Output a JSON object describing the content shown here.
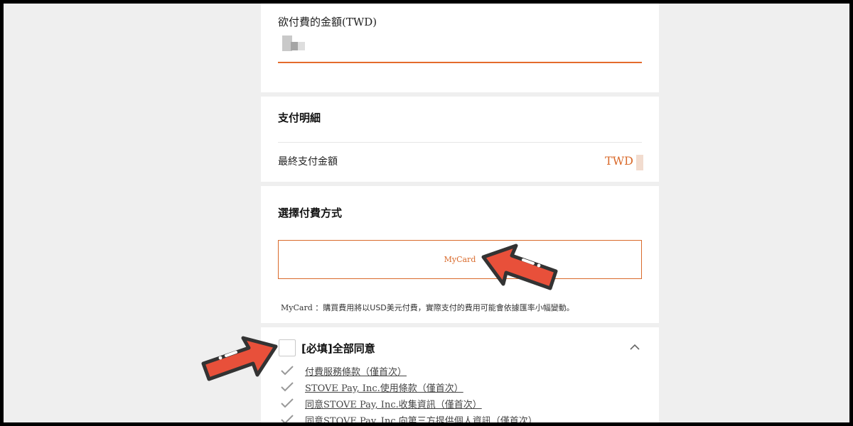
{
  "amount": {
    "label": "欲付費的金額(TWD)"
  },
  "details": {
    "title": "支付明細",
    "final_label": "最終支付金額",
    "final_currency": "TWD"
  },
  "payment": {
    "title": "選擇付費方式",
    "method_label": "MyCard",
    "notice_brand": "MyCard",
    "notice_text": "：購買費用將以USD美元付費，實際支付的費用可能會依據匯率小幅變動。"
  },
  "agreement": {
    "all_label": "[必填]全部同意",
    "terms": [
      "付費服務條款（僅首次）",
      "STOVE Pay, Inc.使用條款（僅首次）",
      "同意STOVE Pay, Inc.收集資訊（僅首次）",
      "同意STOVE Pay, Inc.向第三方提供個人資訊（僅首次）"
    ]
  },
  "colors": {
    "accent": "#d96a2b",
    "arrow_fill": "#e8503a",
    "background": "#efefef"
  }
}
